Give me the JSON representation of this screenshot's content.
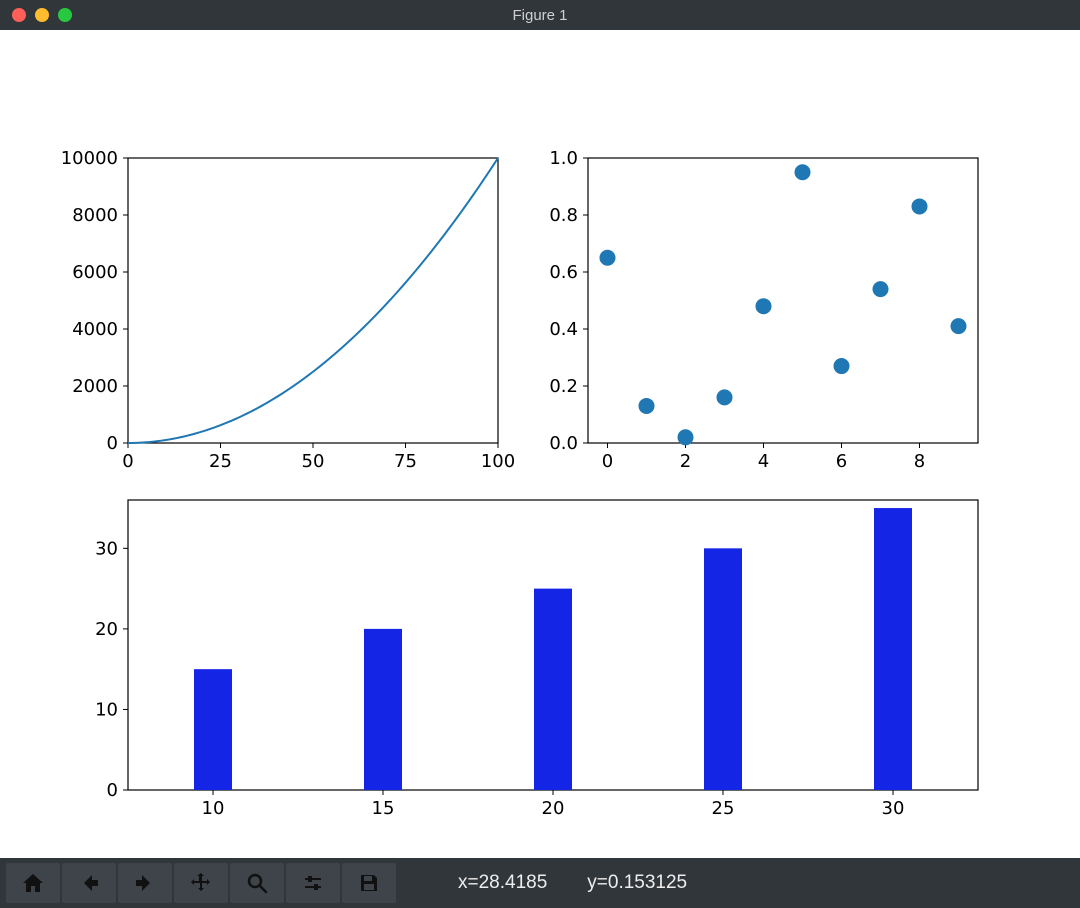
{
  "window": {
    "title": "Figure 1"
  },
  "toolbar": {
    "buttons": [
      "home",
      "back",
      "forward",
      "pan",
      "zoom",
      "configure",
      "save"
    ],
    "coord_x_label": "x=28.4185",
    "coord_y_label": "y=0.153125"
  },
  "chart_data": [
    {
      "id": "line",
      "type": "line",
      "x": [
        0,
        10,
        20,
        30,
        40,
        50,
        60,
        70,
        80,
        90,
        100
      ],
      "y": [
        0,
        100,
        400,
        900,
        1600,
        2500,
        3600,
        4900,
        6400,
        8100,
        10000
      ],
      "xlim": [
        0,
        100
      ],
      "ylim": [
        0,
        10000
      ],
      "xticks": [
        0,
        25,
        50,
        75,
        100
      ],
      "yticks": [
        0,
        2000,
        4000,
        6000,
        8000,
        10000
      ],
      "title": "",
      "xlabel": "",
      "ylabel": ""
    },
    {
      "id": "scatter",
      "type": "scatter",
      "x": [
        0,
        1,
        2,
        3,
        4,
        5,
        6,
        7,
        8,
        9
      ],
      "y": [
        0.65,
        0.13,
        0.02,
        0.16,
        0.48,
        0.95,
        0.27,
        0.54,
        0.83,
        0.41
      ],
      "xlim": [
        -0.5,
        9.5
      ],
      "ylim": [
        0.0,
        1.0
      ],
      "xticks": [
        0,
        2,
        4,
        6,
        8
      ],
      "yticks": [
        0.0,
        0.2,
        0.4,
        0.6,
        0.8,
        1.0
      ],
      "title": "",
      "xlabel": "",
      "ylabel": ""
    },
    {
      "id": "bar",
      "type": "bar",
      "categories": [
        10,
        15,
        20,
        25,
        30
      ],
      "values": [
        15,
        20,
        25,
        30,
        35
      ],
      "xticks": [
        10,
        15,
        20,
        25,
        30
      ],
      "yticks": [
        0,
        10,
        20,
        30
      ],
      "ylim": [
        0,
        36
      ],
      "title": "",
      "xlabel": "",
      "ylabel": ""
    }
  ]
}
